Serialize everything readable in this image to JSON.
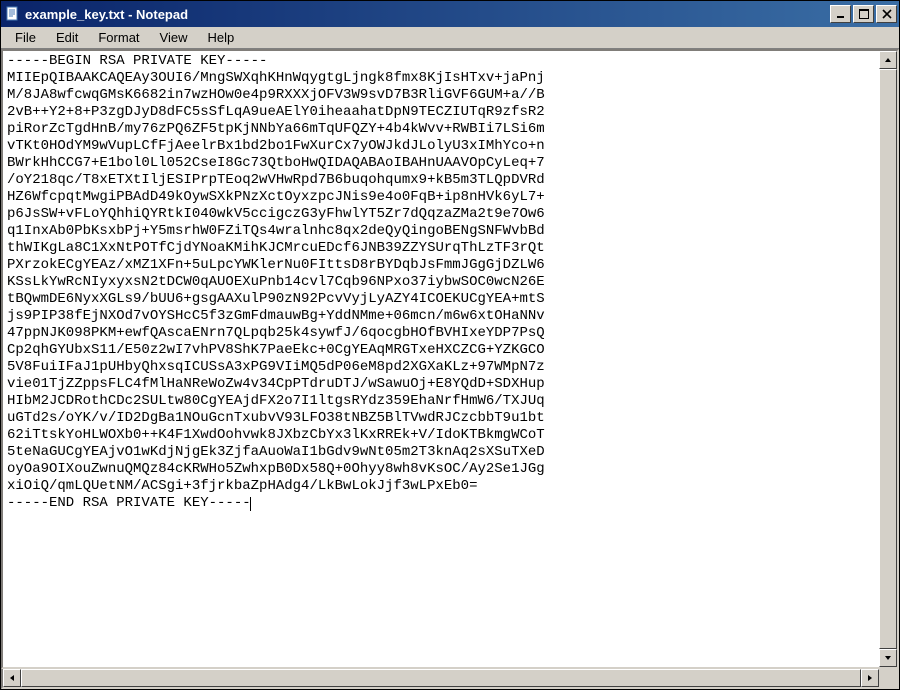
{
  "window": {
    "title": "example_key.txt - Notepad",
    "icon": "notepad-icon"
  },
  "menu": {
    "items": [
      "File",
      "Edit",
      "Format",
      "View",
      "Help"
    ]
  },
  "controls": {
    "minimize": "minimize",
    "maximize": "maximize",
    "close": "close"
  },
  "content": {
    "lines": [
      "-----BEGIN RSA PRIVATE KEY-----",
      "MIIEpQIBAAKCAQEAy3OUI6/MngSWXqhKHnWqygtgLjngk8fmx8KjIsHTxv+jaPnj",
      "M/8JA8wfcwqGMsK6682in7wzHOw0e4p9RXXXjOFV3W9svD7B3RliGVF6GUM+a//B",
      "2vB++Y2+8+P3zgDJyD8dFC5sSfLqA9ueAElY0iheaahatDpN9TECZIUTqR9zfsR2",
      "piRorZcTgdHnB/my76zPQ6ZF5tpKjNNbYa66mTqUFQZY+4b4kWvv+RWBIi7LSi6m",
      "vTKt0HOdYM9wVupLCfFjAeelrBx1bd2bo1FwXurCx7yOWJkdJLolyU3xIMhYco+n",
      "BWrkHhCCG7+E1bol0Ll052CseI8Gc73QtboHwQIDAQABAoIBAHnUAAVOpCyLeq+7",
      "/oY218qc/T8xETXtIljESIPrpTEoq2wVHwRpd7B6buqohqumx9+kB5m3TLQpDVRd",
      "HZ6WfcpqtMwgiPBAdD49kOywSXkPNzXctOyxzpcJNis9e4o0FqB+ip8nHVk6yL7+",
      "p6JsSW+vFLoYQhhiQYRtkI040wkV5ccigczG3yFhwlYT5Zr7dQqzaZMa2t9e7Ow6",
      "q1InxAb0PbKsxbPj+Y5msrhW0FZiTQs4wralnhc8qx2deQyQingoBENgSNFWvbBd",
      "thWIKgLa8C1XxNtPOTfCjdYNoaKMihKJCMrcuEDcf6JNB39ZZYSUrqThLzTF3rQt",
      "PXrzokECgYEAz/xMZ1XFn+5uLpcYWKlerNu0FIttsD8rBYDqbJsFmmJGgGjDZLW6",
      "KSsLkYwRcNIyxyxsN2tDCW0qAUOEXuPnb14cvl7Cqb96NPxo37iybwSOC0wcN26E",
      "tBQwmDE6NyxXGLs9/bUU6+gsgAAXulP90zN92PcvVyjLyAZY4ICOEKUCgYEA+mtS",
      "js9PIP38fEjNXOd7vOYSHcC5f3zGmFdmauwBg+YddNMme+06mcn/m6w6xtOHaNNv",
      "47ppNJK098PKM+ewfQAscaENrn7QLpqb25k4sywfJ/6qocgbHOfBVHIxeYDP7PsQ",
      "Cp2qhGYUbxS11/E50z2wI7vhPV8ShK7PaeEkc+0CgYEAqMRGTxeHXCZCG+YZKGCO",
      "5V8FuiIFaJ1pUHbyQhxsqICUSsA3xPG9VIiMQ5dP06eM8pd2XGXaKLz+97WMpN7z",
      "vie01TjZZppsFLC4fMlHaNReWoZw4v34CpPTdruDTJ/wSawuOj+E8YQdD+SDXHup",
      "HIbM2JCDRothCDc2SULtw80CgYEAjdFX2o7I1ltgsRYdz359EhaNrfHmW6/TXJUq",
      "uGTd2s/oYK/v/ID2DgBa1NOuGcnTxubvV93LFO38tNBZ5BlTVwdRJCzcbbT9u1bt",
      "62iTtskYoHLWOXb0++K4F1XwdOohvwk8JXbzCbYx3lKxRREk+V/IdoKTBkmgWCoT",
      "5teNaGUCgYEAjvO1wKdjNjgEk3ZjfaAuoWaI1bGdv9wNt05m2T3knAq2sXSuTXeD",
      "oyOa9OIXouZwnuQMQz84cKRWHo5ZwhxpB0Dx58Q+0Ohyy8wh8vKsOC/Ay2Se1JGg",
      "xiOiQ/qmLQUetNM/ACSgi+3fjrkbaZpHAdg4/LkBwLokJjf3wLPxEb0=",
      "-----END RSA PRIVATE KEY-----"
    ]
  }
}
